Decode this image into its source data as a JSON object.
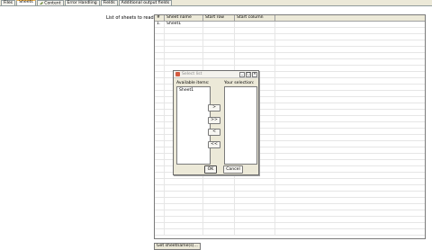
{
  "tabs": [
    {
      "label": "Files"
    },
    {
      "label": "Sheets"
    },
    {
      "label": "Content"
    },
    {
      "label": "Error Handling"
    },
    {
      "label": "Fields"
    },
    {
      "label": "Additional output fields"
    }
  ],
  "sheets": {
    "list_label": "List of sheets to read",
    "columns": [
      "#",
      "Sheet name",
      "Start row",
      "Start column"
    ],
    "rows": [
      {
        "num": "1.",
        "sheet_name": "Sheet1",
        "start_row": "",
        "start_column": ""
      }
    ],
    "get_button_label": "Get sheetname(s)..."
  },
  "dialog": {
    "title": "Select list",
    "available_label": "Available items:",
    "selection_label": "Your selection:",
    "available_items": [
      "Sheet1"
    ],
    "selected_items": [],
    "add_label": ">",
    "add_all_label": ">>",
    "remove_label": "<",
    "remove_all_label": "<<",
    "ok_label": "OK",
    "cancel_label": "Cancel",
    "min_label": "_",
    "max_label": "□",
    "close_label": "×"
  },
  "colors": {
    "active_tab_accent": "#f7b64a",
    "dialog_icon": "#d45a3f"
  }
}
